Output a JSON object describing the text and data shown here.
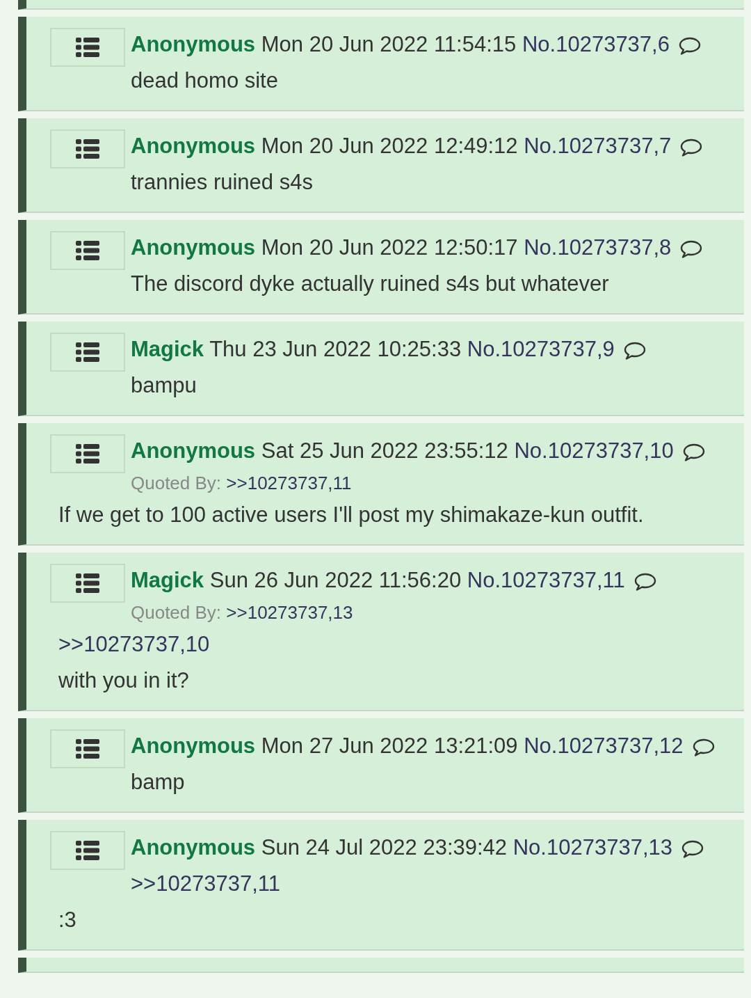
{
  "posts": [
    {
      "name": "Anonymous",
      "date": "Mon 20 Jun 2022 11:54:15",
      "number": "No.10273737,6",
      "body": [
        {
          "kind": "text",
          "text": "dead homo site"
        }
      ]
    },
    {
      "name": "Anonymous",
      "date": "Mon 20 Jun 2022 12:49:12",
      "number": "No.10273737,7",
      "body": [
        {
          "kind": "text",
          "text": "trannies ruined s4s"
        }
      ]
    },
    {
      "name": "Anonymous",
      "date": "Mon 20 Jun 2022 12:50:17",
      "number": "No.10273737,8",
      "body": [
        {
          "kind": "text",
          "text": "The discord dyke actually ruined s4s but whatever"
        }
      ]
    },
    {
      "name": "Magick",
      "date": "Thu 23 Jun 2022 10:25:33",
      "number": "No.10273737,9",
      "body": [
        {
          "kind": "text",
          "text": "bampu"
        }
      ]
    },
    {
      "name": "Anonymous",
      "date": "Sat 25 Jun 2022 23:55:12",
      "number": "No.10273737,10",
      "quoted_by_label": "Quoted By:",
      "quoted_by": ">>10273737,11",
      "body": [
        {
          "kind": "text",
          "text": "If we get to 100 active users I'll post my shimakaze-kun outfit."
        }
      ]
    },
    {
      "name": "Magick",
      "date": "Sun 26 Jun 2022 11:56:20",
      "number": "No.10273737,11",
      "quoted_by_label": "Quoted By:",
      "quoted_by": ">>10273737,13",
      "body": [
        {
          "kind": "quote",
          "text": ">>10273737,10"
        },
        {
          "kind": "text",
          "text": "with you in it?"
        }
      ]
    },
    {
      "name": "Anonymous",
      "date": "Mon 27 Jun 2022 13:21:09",
      "number": "No.10273737,12",
      "body": [
        {
          "kind": "text",
          "text": "bamp"
        }
      ]
    },
    {
      "name": "Anonymous",
      "date": "Sun 24 Jul 2022 23:39:42",
      "number": "No.10273737,13",
      "body": [
        {
          "kind": "quote",
          "text": ">>10273737,11"
        },
        {
          "kind": "text",
          "text": ":3"
        }
      ]
    }
  ]
}
